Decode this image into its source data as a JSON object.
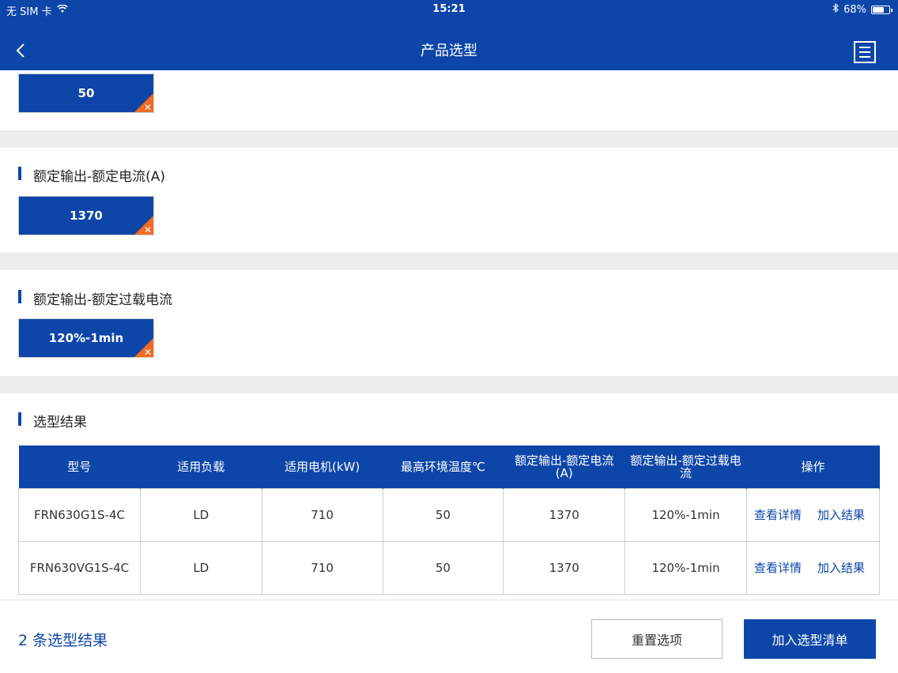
{
  "status": {
    "carrier": "无 SIM 卡",
    "time": "15:21",
    "battery_pct_text": "68%",
    "battery_level": 0.68
  },
  "nav": {
    "title": "产品选型"
  },
  "filters": [
    {
      "title": "",
      "value": "50"
    },
    {
      "title": "额定输出-额定电流(A)",
      "value": "1370"
    },
    {
      "title": "额定输出-额定过载电流",
      "value": "120%-1min"
    }
  ],
  "results": {
    "title": "选型结果",
    "columns": [
      "型号",
      "适用负载",
      "适用电机(kW)",
      "最高环境温度℃",
      "额定输出-额定电流(A)",
      "额定输出-额定过载电流",
      "操作"
    ],
    "rows": [
      {
        "model": "FRN630G1S-4C",
        "load": "LD",
        "motor": "710",
        "temp": "50",
        "current": "1370",
        "overload": "120%-1min",
        "view": "查看详情",
        "add": "加入结果"
      },
      {
        "model": "FRN630VG1S-4C",
        "load": "LD",
        "motor": "710",
        "temp": "50",
        "current": "1370",
        "overload": "120%-1min",
        "view": "查看详情",
        "add": "加入结果"
      }
    ]
  },
  "footer": {
    "count_text": "2 条选型结果",
    "reset_label": "重置选项",
    "add_label": "加入选型清单"
  },
  "colors": {
    "brand": "#0d46a8",
    "accent": "#f36b21",
    "divider": "#ededee"
  }
}
